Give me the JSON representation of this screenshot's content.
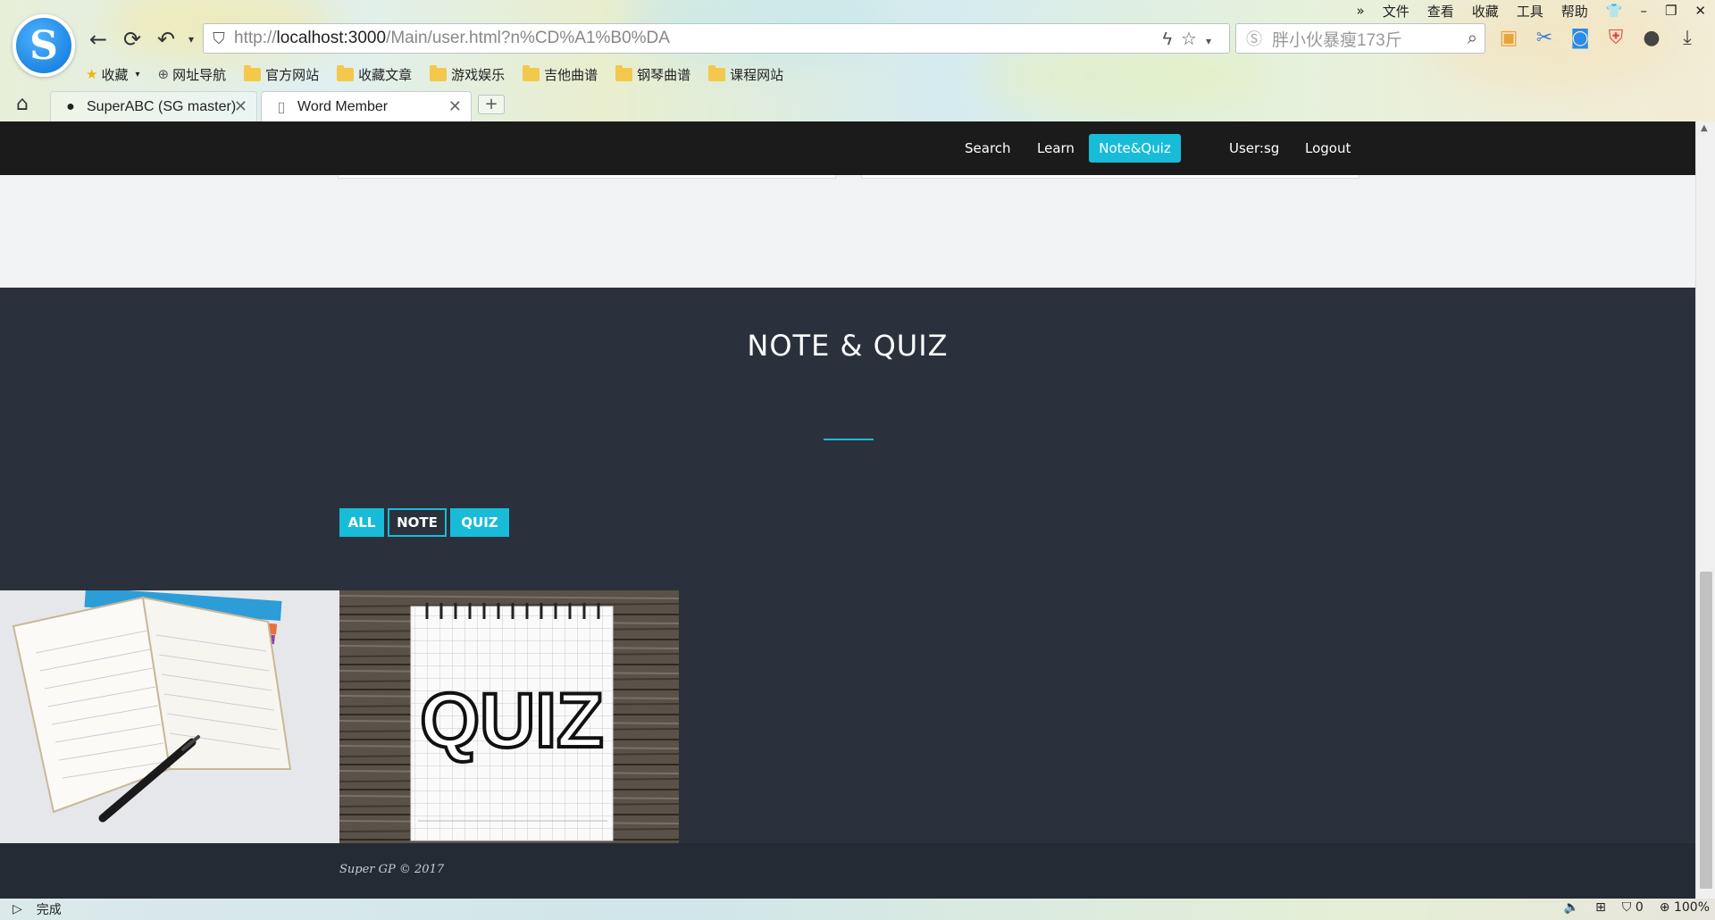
{
  "browser": {
    "top_menu": [
      "文件",
      "查看",
      "收藏",
      "工具",
      "帮助"
    ],
    "url_prefix": "http://",
    "url_host": "localhost:3000",
    "url_path": "/Main/user.html?n%CD%A1%B0%DA",
    "search_placeholder": "胖小伙暴瘦173斤",
    "bookmarks": [
      {
        "label": "收藏",
        "icon": "star-icon"
      },
      {
        "label": "网址导航",
        "icon": "globe-icon"
      },
      {
        "label": "官方网站",
        "icon": "folder-icon"
      },
      {
        "label": "收藏文章",
        "icon": "folder-icon"
      },
      {
        "label": "游戏娱乐",
        "icon": "folder-icon"
      },
      {
        "label": "吉他曲谱",
        "icon": "folder-icon"
      },
      {
        "label": "钢琴曲谱",
        "icon": "folder-icon"
      },
      {
        "label": "课程网站",
        "icon": "folder-icon"
      }
    ],
    "tabs": [
      {
        "label": "SuperABC (SG master)",
        "icon": "github-icon"
      },
      {
        "label": "Word Member",
        "icon": "document-icon"
      }
    ],
    "status_text": "完成",
    "status_count": "0",
    "zoom": "100%"
  },
  "site": {
    "nav": {
      "search": "Search",
      "learn": "Learn",
      "notequiz": "Note&Quiz",
      "user": "User:sg",
      "logout": "Logout"
    },
    "section_title": "NOTE & QUIZ",
    "filters": {
      "all": "ALL",
      "note": "NOTE",
      "quiz": "QUIZ"
    },
    "quiz_image_text": "QUIZ",
    "footer": "Super GP © 2017"
  },
  "colors": {
    "accent": "#18bcd8",
    "nav_bg": "#1b1b1b",
    "section_bg": "#2a313c",
    "footer_bg": "#252b35"
  }
}
